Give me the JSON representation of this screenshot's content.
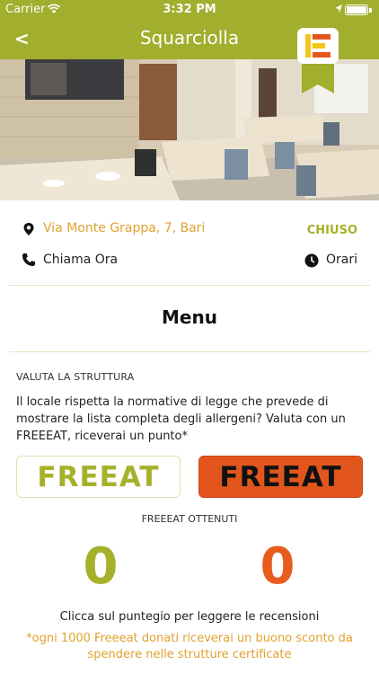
{
  "status_bar": {
    "carrier": "Carrier",
    "time": "3:32 PM"
  },
  "nav": {
    "back_label": "<",
    "title": "Squarciolla"
  },
  "restaurant": {
    "address": "Via Monte Grappa, 7, Bari",
    "open_status": "CHIUSO",
    "call_label": "Chiama Ora",
    "hours_label": "Orari"
  },
  "menu": {
    "title": "Menu"
  },
  "rating": {
    "section_label": "VALUTA LA STRUTTURA",
    "question": "Il locale rispetta la normative di legge che prevede di mostrare la lista completa degli allergeni? Valuta con un FREEEAT, riceverai un punto*",
    "button_yes_label": "FREEAT",
    "button_no_label": "FREEAT",
    "obtained_label": "FREEEAT OTTENUTI",
    "score_yes": "0",
    "score_no": "0",
    "reviews_hint": "Clicca sul puntegio per leggere le recensioni",
    "footnote": "*ogni 1000 Freeeat donati riceverai un buono sconto da spendere nelle strutture certificate"
  },
  "colors": {
    "header": "#a2ae2d",
    "accent_green": "#a6b12a",
    "accent_orange": "#e2561d",
    "address": "#e0a12c"
  },
  "icons": {
    "location": "map-pin-icon",
    "phone": "phone-icon",
    "clock": "clock-icon",
    "wifi": "wifi-icon",
    "battery": "battery-icon",
    "brand": "freeeat-logo-icon"
  }
}
